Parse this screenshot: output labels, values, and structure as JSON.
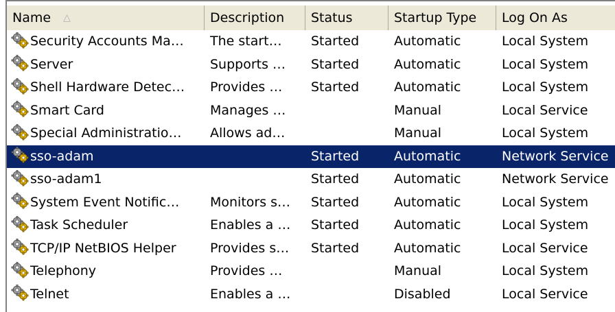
{
  "columns": {
    "name": "Name",
    "description": "Description",
    "status": "Status",
    "startup_type": "Startup Type",
    "log_on_as": "Log On As"
  },
  "colors": {
    "selection": "#0a246a",
    "header_bg": "#ece9d8",
    "gear_gray": "#9a9a9a",
    "gear_gold": "#e0b000"
  },
  "services": [
    {
      "name": "Security Accounts Ma…",
      "description": "The start…",
      "status": "Started",
      "startup": "Automatic",
      "logon": "Local System",
      "icon": "service-gear-icon"
    },
    {
      "name": "Server",
      "description": "Supports …",
      "status": "Started",
      "startup": "Automatic",
      "logon": "Local System",
      "icon": "service-gear-icon"
    },
    {
      "name": "Shell Hardware Detec…",
      "description": "Provides …",
      "status": "Started",
      "startup": "Automatic",
      "logon": "Local System",
      "icon": "service-gear-icon"
    },
    {
      "name": "Smart Card",
      "description": "Manages …",
      "status": "",
      "startup": "Manual",
      "logon": "Local Service",
      "icon": "service-gear-icon"
    },
    {
      "name": "Special Administratio…",
      "description": "Allows ad…",
      "status": "",
      "startup": "Manual",
      "logon": "Local System",
      "icon": "service-gear-icon"
    },
    {
      "name": "sso-adam",
      "description": "",
      "status": "Started",
      "startup": "Automatic",
      "logon": "Network Service",
      "icon": "service-gear-icon",
      "selected": true
    },
    {
      "name": "sso-adam1",
      "description": "",
      "status": "Started",
      "startup": "Automatic",
      "logon": "Network Service",
      "icon": "service-gear-icon"
    },
    {
      "name": "System Event Notific…",
      "description": "Monitors s…",
      "status": "Started",
      "startup": "Automatic",
      "logon": "Local System",
      "icon": "service-gear-icon"
    },
    {
      "name": "Task Scheduler",
      "description": "Enables a …",
      "status": "Started",
      "startup": "Automatic",
      "logon": "Local System",
      "icon": "service-gear-icon"
    },
    {
      "name": "TCP/IP NetBIOS Helper",
      "description": "Provides s…",
      "status": "Started",
      "startup": "Automatic",
      "logon": "Local Service",
      "icon": "service-gear-icon"
    },
    {
      "name": "Telephony",
      "description": "Provides …",
      "status": "",
      "startup": "Manual",
      "logon": "Local System",
      "icon": "service-gear-icon"
    },
    {
      "name": "Telnet",
      "description": "Enables a …",
      "status": "",
      "startup": "Disabled",
      "logon": "Local Service",
      "icon": "service-gear-icon"
    }
  ]
}
